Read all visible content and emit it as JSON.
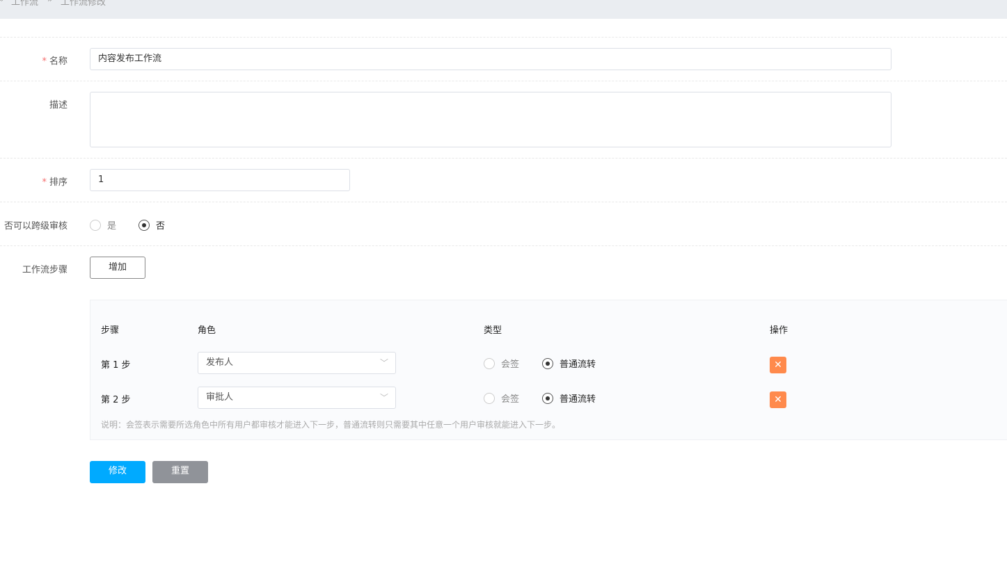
{
  "breadcrumb": {
    "sep": "»",
    "items": [
      "工作流",
      "工作流修改"
    ]
  },
  "form": {
    "name": {
      "label": "名称",
      "required": "*",
      "value": "内容发布工作流"
    },
    "description": {
      "label": "描述",
      "value": ""
    },
    "order": {
      "label": "排序",
      "required": "*",
      "value": "1"
    },
    "skip": {
      "label": "否可以跨级审核",
      "options": [
        "是",
        "否"
      ],
      "selected": "否"
    },
    "steps": {
      "label": "工作流步骤",
      "add_label": "增加"
    }
  },
  "steps_table": {
    "headers": [
      "步骤",
      "角色",
      "类型",
      "操作"
    ],
    "rows": [
      {
        "step": "第 1 步",
        "role": "发布人",
        "types": [
          "会签",
          "普通流转"
        ],
        "selected": "普通流转",
        "delete": "✕"
      },
      {
        "step": "第 2 步",
        "role": "审批人",
        "types": [
          "会签",
          "普通流转"
        ],
        "selected": "普通流转",
        "delete": "✕"
      }
    ],
    "note": "说明：会签表示需要所选角色中所有用户都审核才能进入下一步，普通流转则只需要其中任意一个用户审核就能进入下一步。"
  },
  "actions": {
    "submit": "修改",
    "reset": "重置"
  },
  "colors": {
    "primary": "#00aaff",
    "reset": "#909399",
    "delete": "#ff8a4c"
  }
}
